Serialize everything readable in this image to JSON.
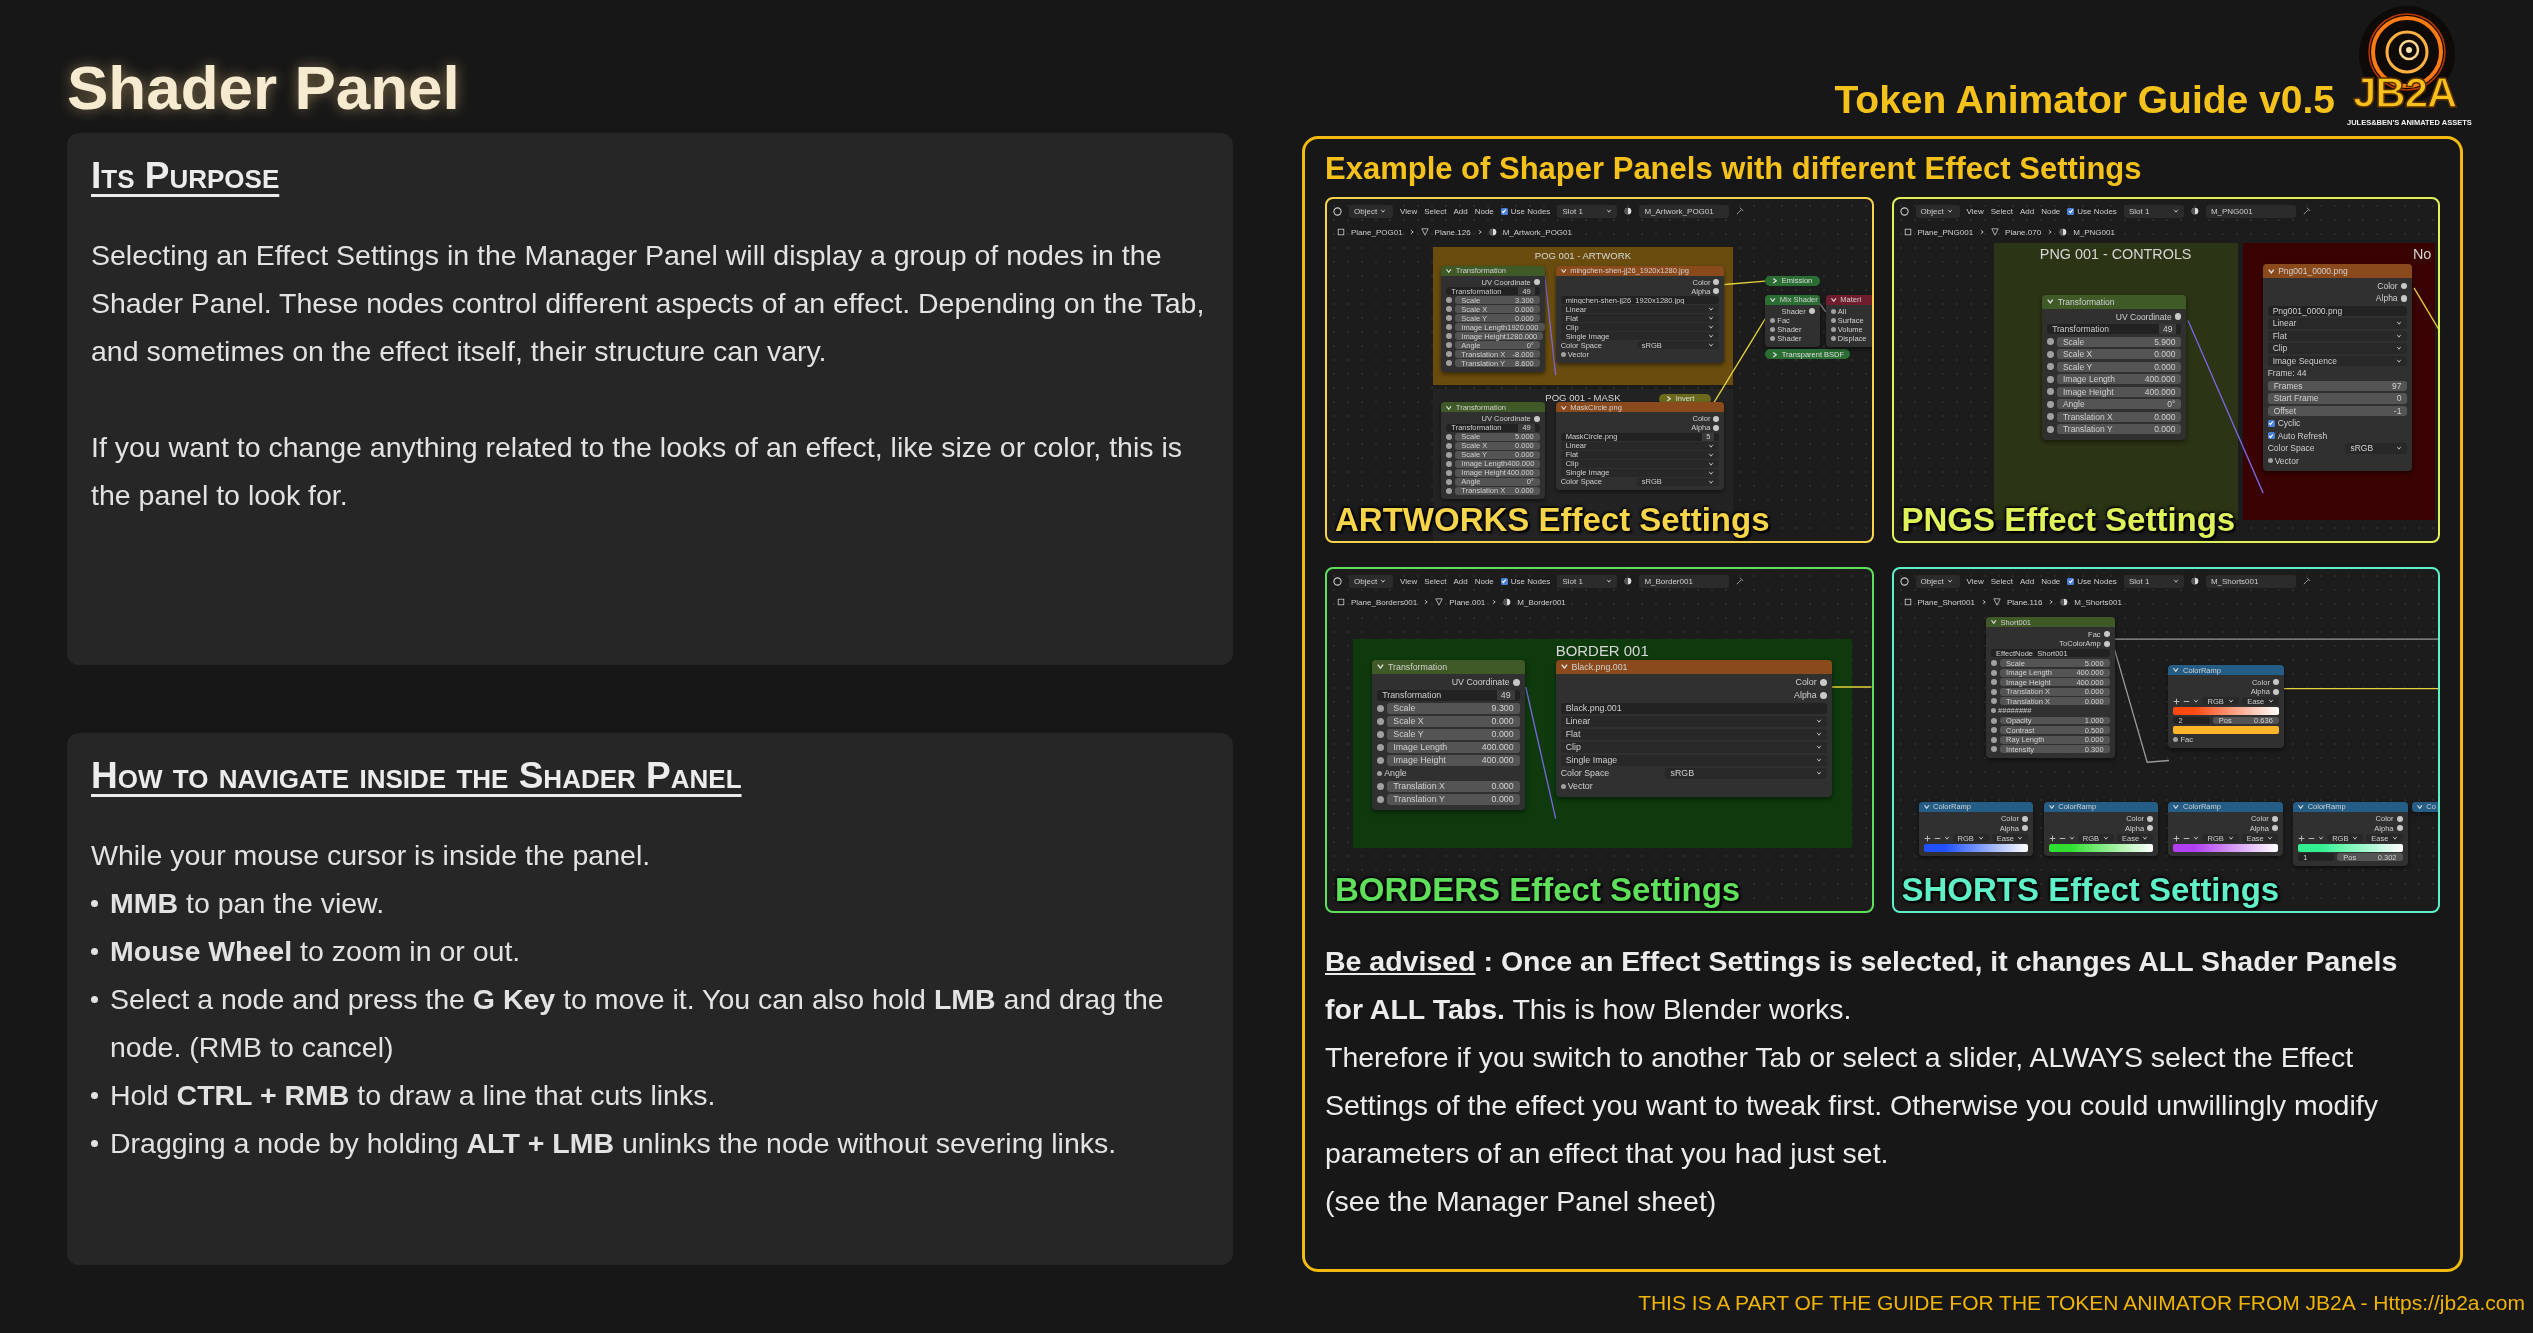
{
  "title": "Shader Panel",
  "guide_title": "Token Animator Guide v0.5",
  "logo": {
    "name": "JB2A",
    "tagline": "JULES&BEN'S ANIMATED ASSETS"
  },
  "purpose": {
    "heading": "Its Purpose",
    "paragraphs": [
      "Selecting an Effect Settings in the Manager Panel will display a group of nodes in the Shader Panel. These nodes control different aspects of an effect. Depending on the Tab, and sometimes on the effect itself, their structure can vary.",
      "If you want to change anything related to the looks of an effect, like size or color, this is the panel to look for."
    ]
  },
  "navigation": {
    "heading": "How to navigate inside the Shader Panel",
    "intro": "While your mouse cursor is inside the panel.",
    "bullets": [
      "**MMB** to pan the view.",
      "**Mouse Wheel** to zoom in or out.",
      "Select a node and press the **G Key** to move it. You can also hold **LMB** and drag the node. (RMB to cancel)",
      "Hold **CTRL + RMB** to draw a line that cuts links.",
      "Dragging a node by holding **ALT + LMB** unlinks the node without severing links."
    ]
  },
  "examples": {
    "heading": "Example of Shaper Panels with different Effect Settings",
    "screenshots": [
      {
        "label": "ARTWORKS Effect Settings",
        "color": "#f7d54a",
        "toolbar": {
          "mode": "Object",
          "menus": [
            "View",
            "Select",
            "Add",
            "Node"
          ],
          "use_nodes": {
            "label": "Use Nodes",
            "checked": true
          },
          "slot": "Slot 1",
          "material": "M_Artwork_POG01"
        },
        "breadcrumb": [
          "Plane_POG01",
          "Plane.126",
          "M_Artwork_POG01"
        ],
        "frames": [
          {
            "title": "POG 001 - ARTWORK",
            "color": "#6a4d0e"
          },
          {
            "title": "POG 001 - MASK",
            "color": "#232323"
          }
        ],
        "nodes": [
          {
            "title": "Transformation",
            "kind": "group",
            "collapsed": false,
            "rows": [
              {
                "kind": "output",
                "label": "UV Coordinate"
              },
              {
                "kind": "field",
                "label": "Transformation",
                "value": "49"
              },
              {
                "kind": "slider",
                "label": "Scale",
                "value": "3.300"
              },
              {
                "kind": "slider",
                "label": "Scale X",
                "value": "0.000"
              },
              {
                "kind": "slider",
                "label": "Scale Y",
                "value": "0.000"
              },
              {
                "kind": "slider",
                "label": "Image Length",
                "value": "1920.000"
              },
              {
                "kind": "slider",
                "label": "Image Height",
                "value": "1280.000"
              },
              {
                "kind": "slider",
                "label": "Angle",
                "value": "0°"
              },
              {
                "kind": "slider",
                "label": "Translation X",
                "value": "-8.000"
              },
              {
                "kind": "slider",
                "label": "Translation Y",
                "value": "8.600"
              }
            ]
          },
          {
            "title": "mingchen-shen-jj26_1920x1280.jpg",
            "kind": "texture",
            "collapsed": false,
            "rows": [
              {
                "kind": "output",
                "label": "Color"
              },
              {
                "kind": "output",
                "label": "Alpha"
              },
              {
                "kind": "field",
                "label": "mingchen-shen-jj26_1920x1280.jpg"
              },
              {
                "kind": "dropdown",
                "label": "Linear"
              },
              {
                "kind": "dropdown",
                "label": "Flat"
              },
              {
                "kind": "dropdown",
                "label": "Clip"
              },
              {
                "kind": "dropdown",
                "label": "Single Image"
              },
              {
                "kind": "prop",
                "label": "Color Space",
                "value": "sRGB"
              },
              {
                "kind": "input",
                "label": "Vector"
              }
            ]
          },
          {
            "title": "Emission",
            "kind": "shader",
            "collapsed": true
          },
          {
            "title": "Mix Shader",
            "kind": "shader",
            "collapsed": false,
            "rows": [
              {
                "kind": "output",
                "label": "Shader"
              },
              {
                "kind": "input",
                "label": "Fac"
              },
              {
                "kind": "input",
                "label": "Shader"
              },
              {
                "kind": "input",
                "label": "Shader"
              }
            ]
          },
          {
            "title": "Transparent BSDF",
            "kind": "shader",
            "collapsed": true
          },
          {
            "title": "Materi",
            "kind": "output",
            "collapsed": false,
            "rows": [
              {
                "kind": "input",
                "label": "All"
              },
              {
                "kind": "input",
                "label": "Surface"
              },
              {
                "kind": "input",
                "label": "Volume"
              },
              {
                "kind": "input",
                "label": "Displace"
              }
            ]
          },
          {
            "title": "Invert",
            "kind": "color",
            "collapsed": true
          },
          {
            "title": "Transformation",
            "kind": "group",
            "collapsed": false,
            "rows": [
              {
                "kind": "output",
                "label": "UV Coordinate"
              },
              {
                "kind": "field",
                "label": "Transformation",
                "value": "49"
              },
              {
                "kind": "slider",
                "label": "Scale",
                "value": "5.000"
              },
              {
                "kind": "slider",
                "label": "Scale X",
                "value": "0.000"
              },
              {
                "kind": "slider",
                "label": "Scale Y",
                "value": "0.000"
              },
              {
                "kind": "slider",
                "label": "Image Length",
                "value": "400.000"
              },
              {
                "kind": "slider",
                "label": "Image Height",
                "value": "400.000"
              },
              {
                "kind": "slider",
                "label": "Angle",
                "value": "0°"
              },
              {
                "kind": "slider",
                "label": "Translation X",
                "value": "0.000"
              }
            ]
          },
          {
            "title": "MaskCircle.png",
            "kind": "texture",
            "collapsed": false,
            "rows": [
              {
                "kind": "output",
                "label": "Color"
              },
              {
                "kind": "output",
                "label": "Alpha"
              },
              {
                "kind": "field",
                "label": "MaskCircle.png",
                "value": "5"
              },
              {
                "kind": "dropdown",
                "label": "Linear"
              },
              {
                "kind": "dropdown",
                "label": "Flat"
              },
              {
                "kind": "dropdown",
                "label": "Clip"
              },
              {
                "kind": "dropdown",
                "label": "Single Image"
              },
              {
                "kind": "prop",
                "label": "Color Space",
                "value": "sRGB"
              }
            ]
          }
        ]
      },
      {
        "label": "PNGS Effect Settings",
        "color": "#dff25a",
        "toolbar": {
          "mode": "Object",
          "menus": [
            "View",
            "Select",
            "Add",
            "Node"
          ],
          "use_nodes": {
            "label": "Use Nodes",
            "checked": true
          },
          "slot": "Slot 1",
          "material": "M_PNG001"
        },
        "breadcrumb": [
          "Plane_PNG001",
          "Plane.070",
          "M_PNG001"
        ],
        "frames": [
          {
            "title": "PNG 001 - CONTROLS",
            "color": "#2b3414"
          },
          {
            "title": "No",
            "color": "#3a0303"
          }
        ],
        "nodes": [
          {
            "title": "Transformation",
            "kind": "group",
            "collapsed": false,
            "rows": [
              {
                "kind": "output",
                "label": "UV Coordinate"
              },
              {
                "kind": "field",
                "label": "Transformation",
                "value": "49"
              },
              {
                "kind": "slider",
                "label": "Scale",
                "value": "5.900"
              },
              {
                "kind": "slider",
                "label": "Scale X",
                "value": "0.000"
              },
              {
                "kind": "slider",
                "label": "Scale Y",
                "value": "0.000"
              },
              {
                "kind": "slider",
                "label": "Image Length",
                "value": "400.000"
              },
              {
                "kind": "slider",
                "label": "Image Height",
                "value": "400.000"
              },
              {
                "kind": "slider",
                "label": "Angle",
                "value": "0°"
              },
              {
                "kind": "slider",
                "label": "Translation X",
                "value": "0.000"
              },
              {
                "kind": "slider",
                "label": "Translation Y",
                "value": "0.000"
              }
            ]
          },
          {
            "title": "Png001_0000.png",
            "kind": "texture",
            "collapsed": false,
            "rows": [
              {
                "kind": "output",
                "label": "Color"
              },
              {
                "kind": "output",
                "label": "Alpha"
              },
              {
                "kind": "field",
                "label": "Png001_0000.png"
              },
              {
                "kind": "dropdown",
                "label": "Linear"
              },
              {
                "kind": "dropdown",
                "label": "Flat"
              },
              {
                "kind": "dropdown",
                "label": "Clip"
              },
              {
                "kind": "dropdown",
                "label": "Image Sequence"
              },
              {
                "kind": "text",
                "label": "Frame: 44"
              },
              {
                "kind": "value",
                "label": "Frames",
                "value": "97"
              },
              {
                "kind": "value",
                "label": "Start Frame",
                "value": "0"
              },
              {
                "kind": "value",
                "label": "Offset",
                "value": "-1"
              },
              {
                "kind": "check",
                "label": "Cyclic",
                "checked": true
              },
              {
                "kind": "check",
                "label": "Auto Refresh",
                "checked": true
              },
              {
                "kind": "prop",
                "label": "Color Space",
                "value": "sRGB"
              },
              {
                "kind": "input",
                "label": "Vector"
              }
            ]
          }
        ]
      },
      {
        "label": "BORDERS Effect Settings",
        "color": "#5fe05a",
        "toolbar": {
          "mode": "Object",
          "menus": [
            "View",
            "Select",
            "Add",
            "Node"
          ],
          "use_nodes": {
            "label": "Use Nodes",
            "checked": true
          },
          "slot": "Slot 1",
          "material": "M_Border001"
        },
        "breadcrumb": [
          "Plane_Borders001",
          "Plane.001",
          "M_Border001"
        ],
        "frames": [
          {
            "title": "BORDER 001",
            "color": "#0e3a0e"
          }
        ],
        "nodes": [
          {
            "title": "Transformation",
            "kind": "group",
            "collapsed": false,
            "rows": [
              {
                "kind": "output",
                "label": "UV Coordinate"
              },
              {
                "kind": "field",
                "label": "Transformation",
                "value": "49"
              },
              {
                "kind": "slider",
                "label": "Scale",
                "value": "9.300"
              },
              {
                "kind": "slider",
                "label": "Scale X",
                "value": "0.000"
              },
              {
                "kind": "slider",
                "label": "Scale Y",
                "value": "0.000"
              },
              {
                "kind": "slider",
                "label": "Image Length",
                "value": "400.000"
              },
              {
                "kind": "slider",
                "label": "Image Height",
                "value": "400.000"
              },
              {
                "kind": "input",
                "label": "Angle"
              },
              {
                "kind": "slider",
                "label": "Translation X",
                "value": "0.000"
              },
              {
                "kind": "slider",
                "label": "Translation Y",
                "value": "0.000"
              }
            ]
          },
          {
            "title": "Black.png.001",
            "kind": "texture",
            "collapsed": false,
            "rows": [
              {
                "kind": "output",
                "label": "Color"
              },
              {
                "kind": "output",
                "label": "Alpha"
              },
              {
                "kind": "field",
                "label": "Black.png.001"
              },
              {
                "kind": "dropdown",
                "label": "Linear"
              },
              {
                "kind": "dropdown",
                "label": "Flat"
              },
              {
                "kind": "dropdown",
                "label": "Clip"
              },
              {
                "kind": "dropdown",
                "label": "Single Image"
              },
              {
                "kind": "prop",
                "label": "Color Space",
                "value": "sRGB"
              },
              {
                "kind": "input",
                "label": "Vector"
              }
            ]
          }
        ]
      },
      {
        "label": "SHORTS Effect Settings",
        "color": "#5ff0c8",
        "toolbar": {
          "mode": "Object",
          "menus": [
            "View",
            "Select",
            "Add",
            "Node"
          ],
          "use_nodes": {
            "label": "Use Nodes",
            "checked": true
          },
          "slot": "Slot 1",
          "material": "M_Shorts001"
        },
        "breadcrumb": [
          "Plane_Short001",
          "Plane.116",
          "M_Shorts001"
        ],
        "nodes": [
          {
            "title": "Short001",
            "kind": "group",
            "collapsed": false,
            "rows": [
              {
                "kind": "output",
                "label": "Fac"
              },
              {
                "kind": "output",
                "label": "ToColorAmp"
              },
              {
                "kind": "field",
                "label": "EffectNode_Short001"
              },
              {
                "kind": "slider",
                "label": "Scale",
                "value": "5.000"
              },
              {
                "kind": "slider",
                "label": "Image Length",
                "value": "400.000"
              },
              {
                "kind": "slider",
                "label": "Image Height",
                "value": "400.000"
              },
              {
                "kind": "slider",
                "label": "Translation X",
                "value": "0.000"
              },
              {
                "kind": "slider",
                "label": "Translation X",
                "value": "0.000"
              },
              {
                "kind": "input",
                "label": "########"
              },
              {
                "kind": "slider",
                "label": "Opacity",
                "value": "1.000"
              },
              {
                "kind": "slider",
                "label": "Contrast",
                "value": "0.500"
              },
              {
                "kind": "slider",
                "label": "Ray Length",
                "value": "0.000"
              },
              {
                "kind": "slider",
                "label": "Intensity",
                "value": "0.300"
              }
            ]
          },
          {
            "title": "ColorRamp",
            "kind": "converter",
            "collapsed": false,
            "rows": [
              {
                "kind": "output",
                "label": "Color"
              },
              {
                "kind": "output",
                "label": "Alpha"
              },
              {
                "kind": "mode",
                "items": [
                  "RGB",
                  "Ease"
                ]
              },
              {
                "kind": "ramp",
                "color": "#ff4a12"
              },
              {
                "kind": "stop",
                "index": "2",
                "label": "Pos",
                "value": "0.636"
              },
              {
                "kind": "swatch",
                "color": "#ffb52a"
              },
              {
                "kind": "input",
                "label": "Fac"
              }
            ]
          },
          {
            "title": "ColorRamp",
            "kind": "converter",
            "collapsed": false,
            "rows": [
              {
                "kind": "output",
                "label": "Color"
              },
              {
                "kind": "output",
                "label": "Alpha"
              },
              {
                "kind": "mode",
                "items": [
                  "RGB",
                  "Ease"
                ]
              },
              {
                "kind": "ramp",
                "color": "#2050ff"
              }
            ]
          },
          {
            "title": "ColorRamp",
            "kind": "converter",
            "collapsed": false,
            "rows": [
              {
                "kind": "output",
                "label": "Color"
              },
              {
                "kind": "output",
                "label": "Alpha"
              },
              {
                "kind": "mode",
                "items": [
                  "RGB",
                  "Ease"
                ]
              },
              {
                "kind": "ramp",
                "color": "#30e030"
              }
            ]
          },
          {
            "title": "ColorRamp",
            "kind": "converter",
            "collapsed": false,
            "rows": [
              {
                "kind": "output",
                "label": "Color"
              },
              {
                "kind": "output",
                "label": "Alpha"
              },
              {
                "kind": "mode",
                "items": [
                  "RGB",
                  "Ease"
                ]
              },
              {
                "kind": "ramp",
                "color": "#b040f0"
              }
            ]
          },
          {
            "title": "ColorRamp",
            "kind": "converter",
            "collapsed": false,
            "rows": [
              {
                "kind": "output",
                "label": "Color"
              },
              {
                "kind": "output",
                "label": "Alpha"
              },
              {
                "kind": "mode",
                "items": [
                  "RGB",
                  "Ease"
                ]
              },
              {
                "kind": "ramp",
                "color": "#30f090"
              },
              {
                "kind": "stop",
                "index": "1",
                "label": "Pos",
                "value": "0.302"
              }
            ]
          },
          {
            "title": "Co",
            "kind": "converter",
            "collapsed": false
          }
        ]
      }
    ]
  },
  "advice": {
    "label": "Be advised",
    "text": "**: Once an Effect Settings is selected, it changes ALL Shader Panels for ALL Tabs.** This is how Blender works.",
    "paragraphs": [
      "Therefore if you switch to another Tab or select a slider, ALWAYS select the Effect Settings of the effect you want to tweak first. Otherwise you could unwillingly modify parameters of an effect that you had just set.",
      "(see the Manager Panel sheet)"
    ]
  },
  "footer": "THIS IS A PART OF THE GUIDE FOR THE TOKEN ANIMATOR FROM JB2A - Https://jb2a.com"
}
